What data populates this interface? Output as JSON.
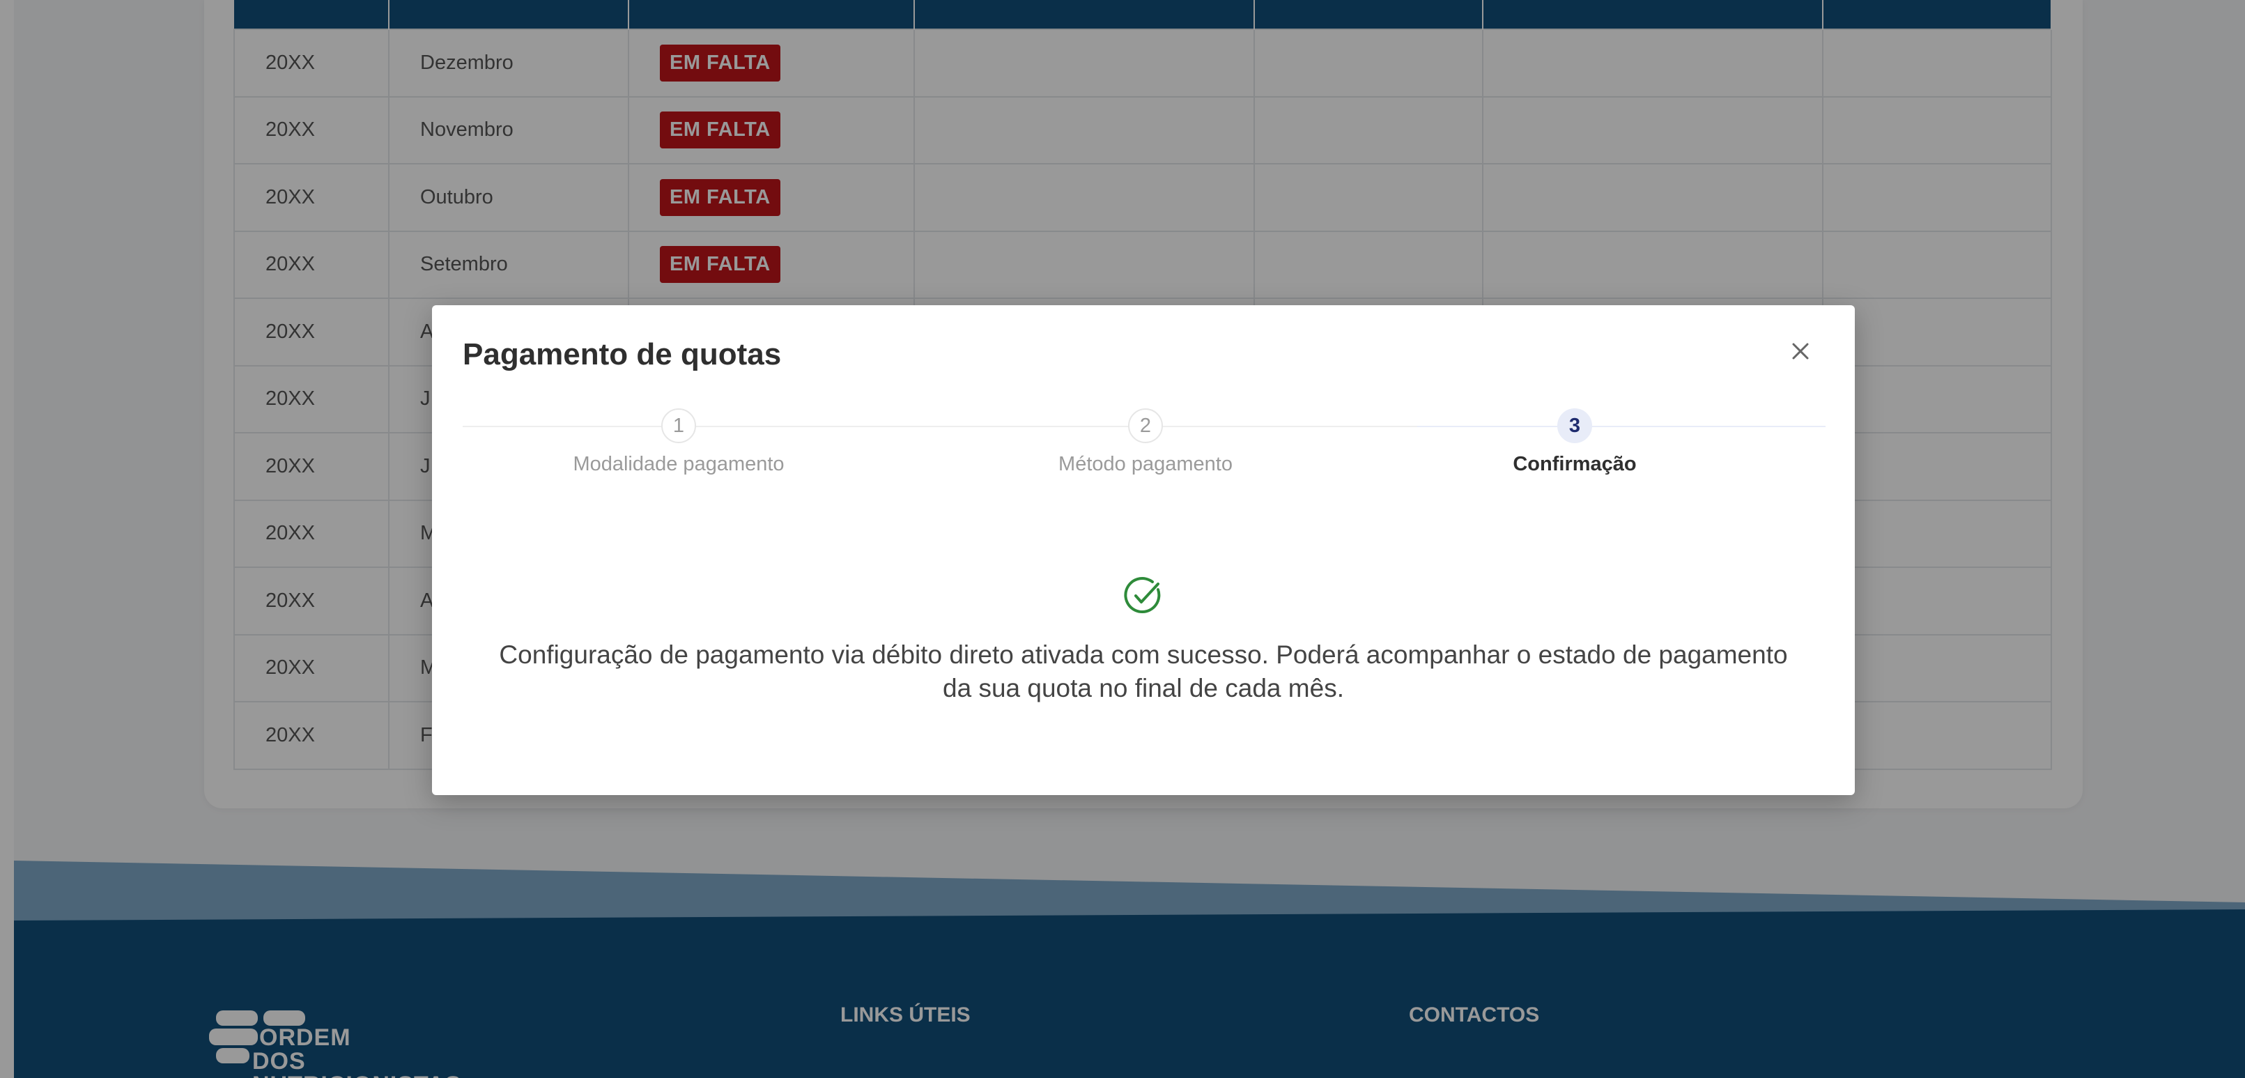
{
  "table": {
    "rows": [
      {
        "year": "20XX",
        "month": "Dezembro",
        "status": "EM FALTA"
      },
      {
        "year": "20XX",
        "month": "Novembro",
        "status": "EM FALTA"
      },
      {
        "year": "20XX",
        "month": "Outubro",
        "status": "EM FALTA"
      },
      {
        "year": "20XX",
        "month": "Setembro",
        "status": "EM FALTA"
      },
      {
        "year": "20XX",
        "month": "A"
      },
      {
        "year": "20XX",
        "month": "J"
      },
      {
        "year": "20XX",
        "month": "J"
      },
      {
        "year": "20XX",
        "month": "M"
      },
      {
        "year": "20XX",
        "month": "A"
      },
      {
        "year": "20XX",
        "month": "M"
      },
      {
        "year": "20XX",
        "month": "F"
      }
    ],
    "colors": {
      "header": "#124f7b",
      "badge": "#c0141a"
    }
  },
  "modal": {
    "title": "Pagamento de quotas",
    "close_icon": "close-icon",
    "steps": [
      {
        "number": "1",
        "label": "Modalidade pagamento"
      },
      {
        "number": "2",
        "label": "Método pagamento"
      },
      {
        "number": "3",
        "label": "Confirmação"
      }
    ],
    "active_step": 3,
    "success_icon": "check-circle-icon",
    "success_color": "#2e8b3a",
    "message": "Configuração de pagamento via débito direto ativada com sucesso. Poderá acompanhar o estado de pagamento da sua quota no final de cada mês."
  },
  "footer": {
    "logo_lines": [
      "ORDEM",
      "DOS",
      "NUTRICIONISTAS"
    ],
    "links_heading": "LINKS ÚTEIS",
    "contacts_heading": "CONTACTOS",
    "colors": {
      "wave_light": "#7fa9c8",
      "wave_dark": "#124f7b"
    }
  }
}
